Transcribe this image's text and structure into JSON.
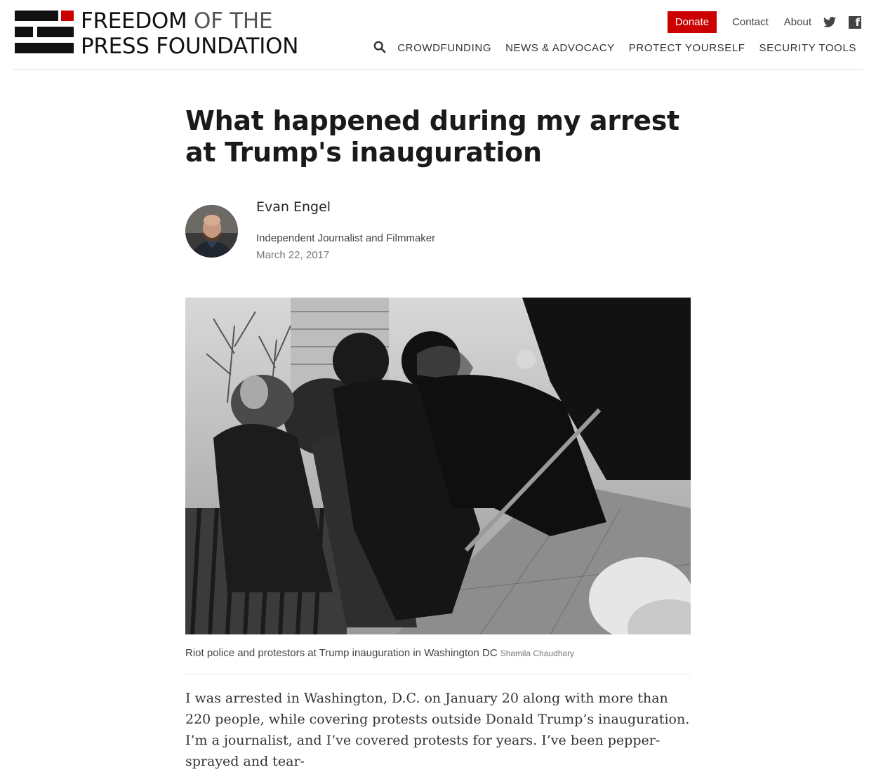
{
  "site": {
    "logo_line1_bold": "FREEDOM",
    "logo_line1_rest": " OF THE",
    "logo_line2": "PRESS FOUNDATION",
    "brand_red": "#cc0000"
  },
  "utility_nav": {
    "donate": "Donate",
    "contact": "Contact",
    "about": "About",
    "icons": [
      "twitter-icon",
      "facebook-icon"
    ]
  },
  "main_nav": {
    "items": [
      "CROWDFUNDING",
      "NEWS & ADVOCACY",
      "PROTECT YOURSELF",
      "SECURITY TOOLS"
    ],
    "search_icon": "search-icon"
  },
  "article": {
    "title": "What happened during my arrest at Trump's inauguration",
    "author": {
      "name": "Evan Engel",
      "role": "Independent Journalist and Filmmaker",
      "date": "March 22, 2017"
    },
    "image": {
      "caption": "Riot police and protestors at Trump inauguration in Washington DC",
      "credit": "Shamila Chaudhary"
    },
    "body": "I was arrested in Washington, D.C. on January 20 along with more than 220 people, while covering protests outside Donald Trump’s inauguration. I’m a journalist, and I’ve covered protests for years. I’ve been pepper-sprayed and tear-"
  }
}
